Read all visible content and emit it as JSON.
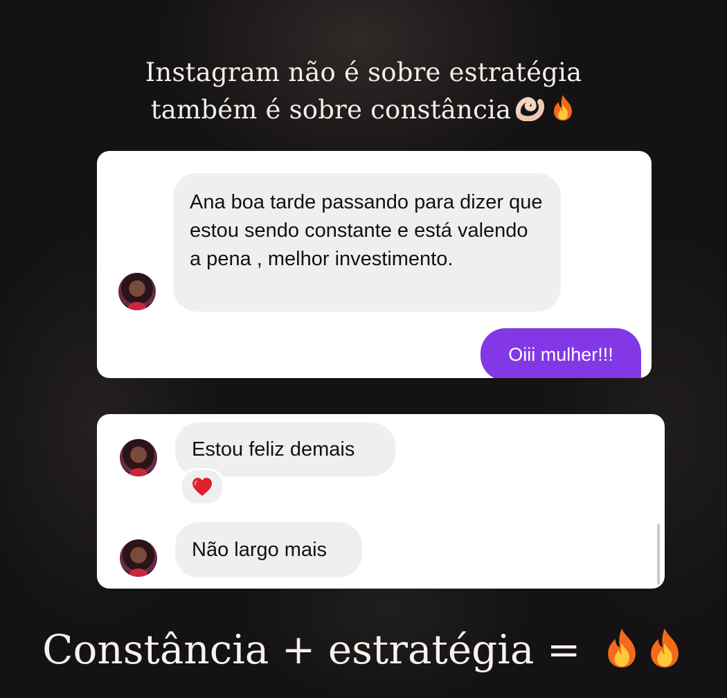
{
  "header": {
    "line1": "Instagram não é sobre estratégia",
    "line2": "também é sobre constância"
  },
  "card1": {
    "incoming_message": "Ana boa tarde passando para dizer que estou sendo constante e está valendo a pena , melhor investimento.",
    "outgoing_message": "Oiii mulher!!!"
  },
  "card2": {
    "message1": "Estou feliz demais",
    "message2": "Não largo mais"
  },
  "footer": {
    "text": "Constância + estratégia ="
  },
  "icons": {
    "pinch": "pinching-hand-icon",
    "fire": "fire-icon",
    "heart": "heart-icon"
  },
  "colors": {
    "outgoing_bubble": "#8338e6",
    "incoming_bubble": "#efefef",
    "background": "#141212"
  }
}
